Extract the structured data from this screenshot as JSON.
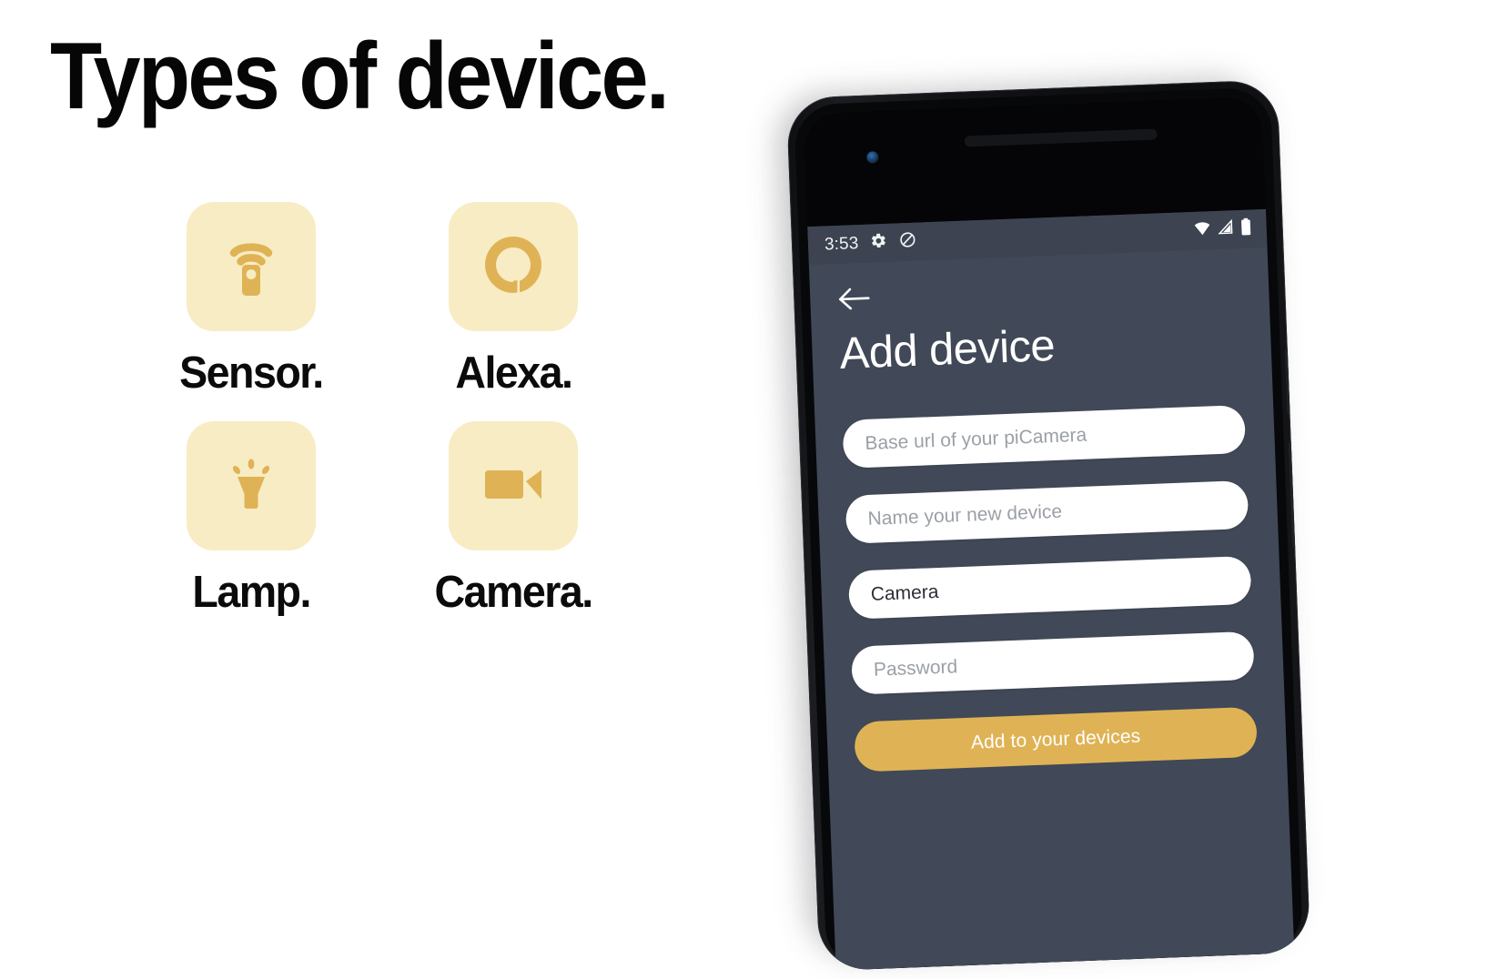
{
  "slide": {
    "title": "Types of device."
  },
  "devices": [
    {
      "label": "Sensor.",
      "icon": "sensor-remote-icon"
    },
    {
      "label": "Alexa.",
      "icon": "alexa-ring-icon"
    },
    {
      "label": "Lamp.",
      "icon": "lamp-icon"
    },
    {
      "label": "Camera.",
      "icon": "video-camera-icon"
    }
  ],
  "phone": {
    "status_bar": {
      "time": "3:53",
      "icons_left": [
        "gear-icon",
        "do-not-disturb-icon"
      ],
      "icons_right": [
        "wifi-icon",
        "cell-signal-icon",
        "battery-icon"
      ]
    },
    "app": {
      "back_label": "back-arrow",
      "title": "Add device",
      "fields": [
        {
          "name": "base-url",
          "placeholder": "Base url of your piCamera",
          "value": ""
        },
        {
          "name": "device-name",
          "placeholder": "Name your new device",
          "value": ""
        },
        {
          "name": "device-type",
          "placeholder": "",
          "value": "Camera"
        },
        {
          "name": "password",
          "placeholder": "Password",
          "value": ""
        }
      ],
      "submit_label": "Add to your devices"
    }
  },
  "colors": {
    "accent": "#dfb355",
    "tile_bg": "#f8ecc4",
    "screen_bg": "#414857",
    "status_bar_bg": "#3d4350",
    "title_text": "#060606"
  }
}
